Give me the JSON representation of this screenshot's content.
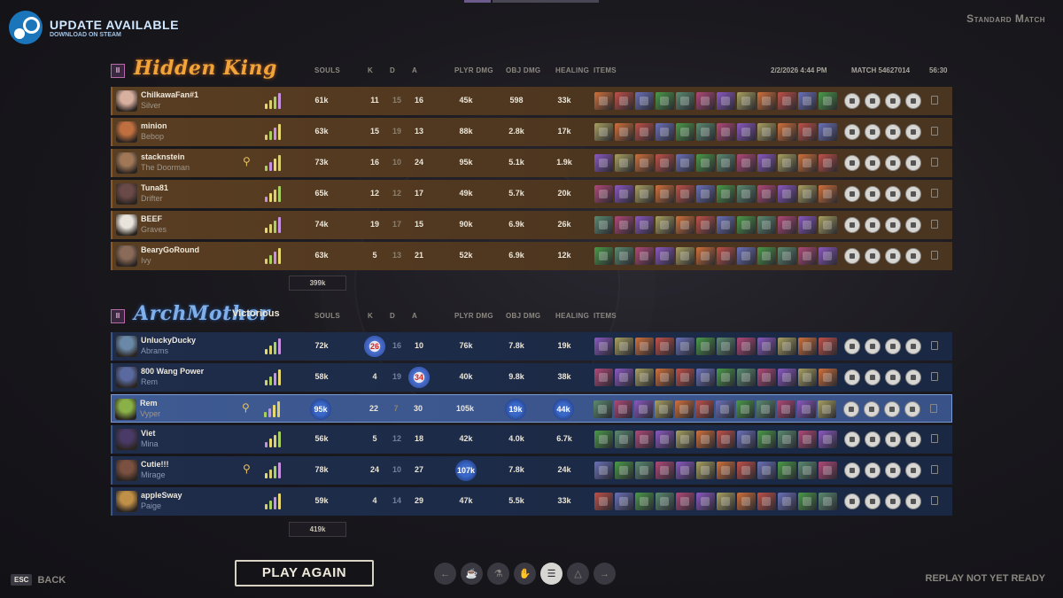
{
  "banner": {
    "title": "UPDATE AVAILABLE",
    "subtitle": "DOWNLOAD ON STEAM"
  },
  "match_type": "Standard Match",
  "columns": {
    "souls": "SOULS",
    "k": "K",
    "d": "D",
    "a": "A",
    "plyr_dmg": "PLYR DMG",
    "obj_dmg": "OBJ DMG",
    "healing": "HEALING",
    "items": "ITEMS"
  },
  "meta": {
    "date": "2/2/2026 4:44 PM",
    "match": "MATCH 54627014",
    "duration": "56:30"
  },
  "teams": [
    {
      "name": "Hidden King",
      "badge": "II",
      "status": "",
      "total_souls": "399k",
      "players": [
        {
          "name": "ChilkawaFan#1",
          "hero": "Silver",
          "souls": "61k",
          "k": "11",
          "d": "15",
          "a": "16",
          "plyr": "45k",
          "obj": "598",
          "heal": "33k",
          "avatar": "#d8b0a0"
        },
        {
          "name": "minion",
          "hero": "Bebop",
          "souls": "63k",
          "k": "15",
          "d": "19",
          "a": "13",
          "plyr": "88k",
          "obj": "2.8k",
          "heal": "17k",
          "avatar": "#c07040"
        },
        {
          "name": "stacknstein",
          "hero": "The Doorman",
          "souls": "73k",
          "k": "16",
          "d": "10",
          "a": "24",
          "plyr": "95k",
          "obj": "5.1k",
          "heal": "1.9k",
          "avatar": "#a07858"
        },
        {
          "name": "Tuna81",
          "hero": "Drifter",
          "souls": "65k",
          "k": "12",
          "d": "12",
          "a": "17",
          "plyr": "49k",
          "obj": "5.7k",
          "heal": "20k",
          "avatar": "#6a4a48"
        },
        {
          "name": "BEEF",
          "hero": "Graves",
          "souls": "74k",
          "k": "19",
          "d": "17",
          "a": "15",
          "plyr": "90k",
          "obj": "6.9k",
          "heal": "26k",
          "avatar": "#e8e4dc"
        },
        {
          "name": "BearyGoRound",
          "hero": "Ivy",
          "souls": "63k",
          "k": "5",
          "d": "13",
          "a": "21",
          "plyr": "52k",
          "obj": "6.9k",
          "heal": "12k",
          "avatar": "#8a6a58"
        }
      ]
    },
    {
      "name": "ArchMother",
      "badge": "II",
      "status": "Victorious",
      "total_souls": "419k",
      "players": [
        {
          "name": "UnluckyDucky",
          "hero": "Abrams",
          "souls": "72k",
          "k": "26",
          "d": "16",
          "a": "10",
          "plyr": "76k",
          "obj": "7.8k",
          "heal": "19k",
          "avatar": "#6a88a8"
        },
        {
          "name": "800 Wang Power",
          "hero": "Rem",
          "souls": "58k",
          "k": "4",
          "d": "19",
          "a": "34",
          "plyr": "40k",
          "obj": "9.8k",
          "heal": "38k",
          "avatar": "#5a6aa0"
        },
        {
          "name": "Rem",
          "hero": "Vyper",
          "souls": "95k",
          "k": "22",
          "d": "7",
          "a": "30",
          "plyr": "105k",
          "obj": "19k",
          "heal": "44k",
          "avatar": "#8ab048"
        },
        {
          "name": "Viet",
          "hero": "Mina",
          "souls": "56k",
          "k": "5",
          "d": "12",
          "a": "18",
          "plyr": "42k",
          "obj": "4.0k",
          "heal": "6.7k",
          "avatar": "#4a3a68"
        },
        {
          "name": "Cutie!!!",
          "hero": "Mirage",
          "souls": "78k",
          "k": "24",
          "d": "10",
          "a": "27",
          "plyr": "107k",
          "obj": "7.8k",
          "heal": "24k",
          "avatar": "#7a5040"
        },
        {
          "name": "appleSway",
          "hero": "Paige",
          "souls": "59k",
          "k": "4",
          "d": "14",
          "a": "29",
          "plyr": "47k",
          "obj": "5.5k",
          "heal": "33k",
          "avatar": "#c09048"
        }
      ]
    }
  ],
  "footer": {
    "esc": "ESC",
    "back": "BACK",
    "play_again": "PLAY AGAIN",
    "replay": "REPLAY NOT YET READY"
  },
  "nav_icons": [
    "arrow-left-icon",
    "trophy-icon",
    "tree-icon",
    "hand-icon",
    "list-icon",
    "chart-icon",
    "arrow-right-icon"
  ],
  "colors": {
    "amber_team": "#f0a43a",
    "blue_team": "#7fb0ec",
    "item_orange": "#d0703a",
    "item_green": "#4a9a48",
    "item_purple": "#8a58c0"
  }
}
